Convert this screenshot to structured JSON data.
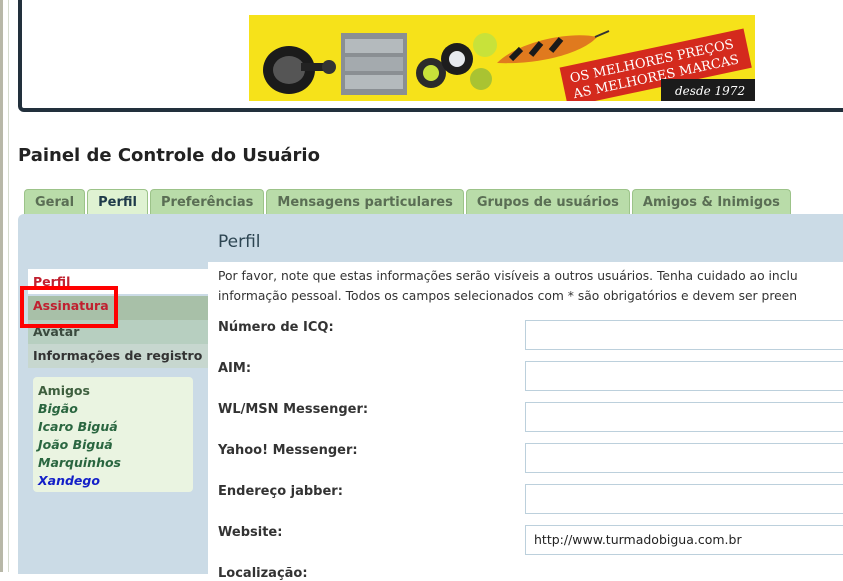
{
  "banner": {
    "text_line1": "OS MELHORES PREÇOS",
    "text_line2": "AS MELHORES MARCAS",
    "since": "desde 1972",
    "bg_color": "#f6e21a",
    "accent_color": "#d42a1d"
  },
  "page": {
    "title": "Painel de Controle do Usuário"
  },
  "tabs": [
    {
      "label": "Geral",
      "active": false
    },
    {
      "label": "Perfil",
      "active": true
    },
    {
      "label": "Preferências",
      "active": false
    },
    {
      "label": "Mensagens particulares",
      "active": false
    },
    {
      "label": "Grupos de usuários",
      "active": false
    },
    {
      "label": "Amigos & Inimigos",
      "active": false
    }
  ],
  "sidebar": {
    "items": [
      {
        "label": "Perfil"
      },
      {
        "label": "Assinatura"
      },
      {
        "label": "Avatar"
      },
      {
        "label": "Informações de registro"
      }
    ],
    "friends": {
      "heading": "Amigos",
      "list": [
        "Bigão",
        "Icaro Biguá",
        "João Biguá",
        "Marquinhos",
        "Xandego"
      ]
    }
  },
  "content": {
    "title": "Perfil",
    "notice_line1": "Por favor, note que estas informações serão visíveis a outros usuários. Tenha cuidado ao inclu",
    "notice_line2": "informação pessoal. Todos os campos selecionados com * são obrigatórios e devem ser preen",
    "fields": [
      {
        "label": "Número de ICQ:",
        "value": ""
      },
      {
        "label": "AIM:",
        "value": ""
      },
      {
        "label": "WL/MSN Messenger:",
        "value": ""
      },
      {
        "label": "Yahoo! Messenger:",
        "value": ""
      },
      {
        "label": "Endereço jabber:",
        "value": ""
      },
      {
        "label": "Website:",
        "value": "http://www.turmadobigua.com.br"
      },
      {
        "label": "Localização:",
        "value": ""
      }
    ]
  }
}
